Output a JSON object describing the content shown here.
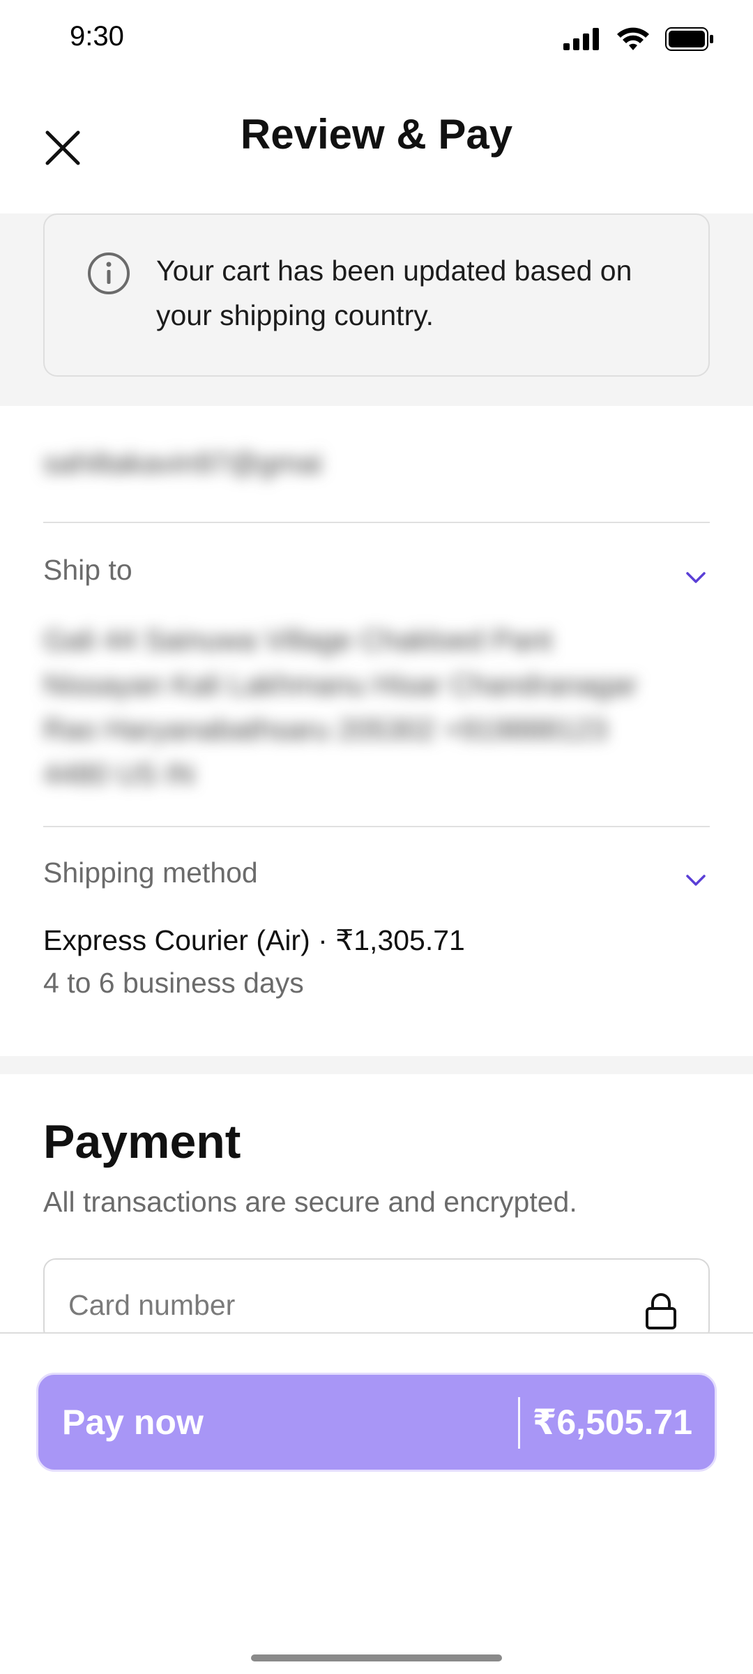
{
  "status_bar": {
    "time": "9:30",
    "icons": [
      "signal-icon",
      "wifi-icon",
      "battery-icon"
    ]
  },
  "header": {
    "title": "Review & Pay",
    "close_icon": "close-icon"
  },
  "notice": {
    "icon": "info-icon",
    "text": "Your cart has been updated based on your shipping country."
  },
  "contact": {
    "email_blurred": "sahiltakavin97@gmai"
  },
  "ship_to": {
    "label": "Ship to",
    "address_blurred": "Gali 44 Sainuwa Village Chakloed Pant Nissayan Kali Lakhmanu Hisar Chandranagar Rao Haryanabathsaru 205302 +919888123 4480 US IN"
  },
  "shipping_method": {
    "label": "Shipping method",
    "method": "Express Courier (Air) · ₹1,305.71",
    "days": "4 to 6 business days"
  },
  "payment": {
    "title": "Payment",
    "subtitle": "All transactions are secure and encrypted.",
    "card_placeholder": "Card number"
  },
  "footer": {
    "pay_label": "Pay now",
    "pay_amount": "₹6,505.71"
  },
  "colors": {
    "accent": "#5a3fd6",
    "pay_button": "#a896f6",
    "band": "#f4f4f4"
  }
}
